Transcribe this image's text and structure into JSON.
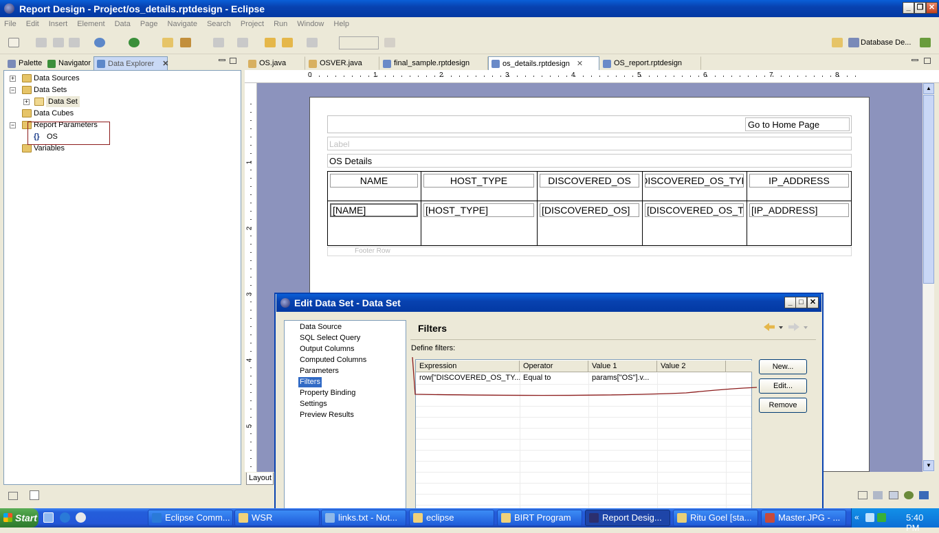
{
  "window": {
    "title": "Report Design - Project/os_details.rptdesign - Eclipse"
  },
  "menu": [
    "File",
    "Edit",
    "Insert",
    "Element",
    "Data",
    "Page",
    "Navigate",
    "Search",
    "Project",
    "Run",
    "Window",
    "Help"
  ],
  "perspective": {
    "label": "Database De..."
  },
  "left_tabs": [
    {
      "label": "Palette",
      "icon": "palette-icon"
    },
    {
      "label": "Navigator",
      "icon": "navigator-icon"
    },
    {
      "label": "Data Explorer",
      "icon": "data-explorer-icon"
    }
  ],
  "tree": {
    "data_sources": "Data Sources",
    "data_sets": "Data Sets",
    "data_set": "Data Set",
    "data_cubes": "Data Cubes",
    "report_parameters": "Report Parameters",
    "os_param": "OS",
    "os_glyph": "{}",
    "variables": "Variables"
  },
  "editor_tabs": [
    {
      "label": "OS.java"
    },
    {
      "label": "OSVER.java"
    },
    {
      "label": "final_sample.rptdesign"
    },
    {
      "label": "os_details.rptdesign"
    },
    {
      "label": "OS_report.rptdesign"
    }
  ],
  "ruler": {
    "h_numbers": [
      "1",
      "2",
      "3",
      "4",
      "5",
      "6",
      "7",
      "8"
    ],
    "v_numbers": [
      "1",
      "2",
      "3",
      "4",
      "5"
    ],
    "zero": "0"
  },
  "report": {
    "home_link": "Go to Home Page",
    "label_placeholder": "Label",
    "title": "OS Details",
    "headers": [
      "NAME",
      "HOST_TYPE",
      "DISCOVERED_OS",
      "DISCOVERED_OS_TYP",
      "IP_ADDRESS"
    ],
    "details": [
      "[NAME]",
      "[HOST_TYPE]",
      "[DISCOVERED_OS]",
      "[DISCOVERED_OS_TYF",
      "[IP_ADDRESS]"
    ],
    "footer": "Footer Row"
  },
  "layout_tab": "Layout",
  "dialog": {
    "title": "Edit Data Set - Data Set",
    "nav": [
      "Data Source",
      "SQL Select Query",
      "Output Columns",
      "Computed Columns",
      "Parameters",
      "Filters",
      "Property Binding",
      "Settings",
      "Preview Results"
    ],
    "selected_nav": "Filters",
    "page_title": "Filters",
    "define_label": "Define filters:",
    "columns": [
      "Expression",
      "Operator",
      "Value 1",
      "Value 2"
    ],
    "rows": [
      {
        "expression": "row[\"DISCOVERED_OS_TY...",
        "operator": "Equal to",
        "value1": "params[\"OS\"].v...",
        "value2": ""
      }
    ],
    "buttons": {
      "new": "New...",
      "edit": "Edit...",
      "remove": "Remove"
    }
  },
  "taskbar": {
    "start": "Start",
    "items": [
      {
        "label": "Eclipse Comm...",
        "icon": "ie-icon"
      },
      {
        "label": "WSR",
        "icon": "folder-icon"
      },
      {
        "label": "links.txt - Not...",
        "icon": "notepad-icon"
      },
      {
        "label": "eclipse",
        "icon": "folder-icon"
      },
      {
        "label": "BIRT Program",
        "icon": "folder-icon"
      },
      {
        "label": "Report Desig...",
        "icon": "eclipse-icon"
      },
      {
        "label": "Ritu Goel [sta...",
        "icon": "chat-icon"
      },
      {
        "label": "Master.JPG - ...",
        "icon": "paint-icon"
      }
    ],
    "clock": "5:40 PM"
  },
  "colors": {
    "xp_blue": "#0842b0",
    "annotation_red": "#8b1a1a",
    "canvas": "#8c93bd",
    "selection": "#316ac5"
  }
}
